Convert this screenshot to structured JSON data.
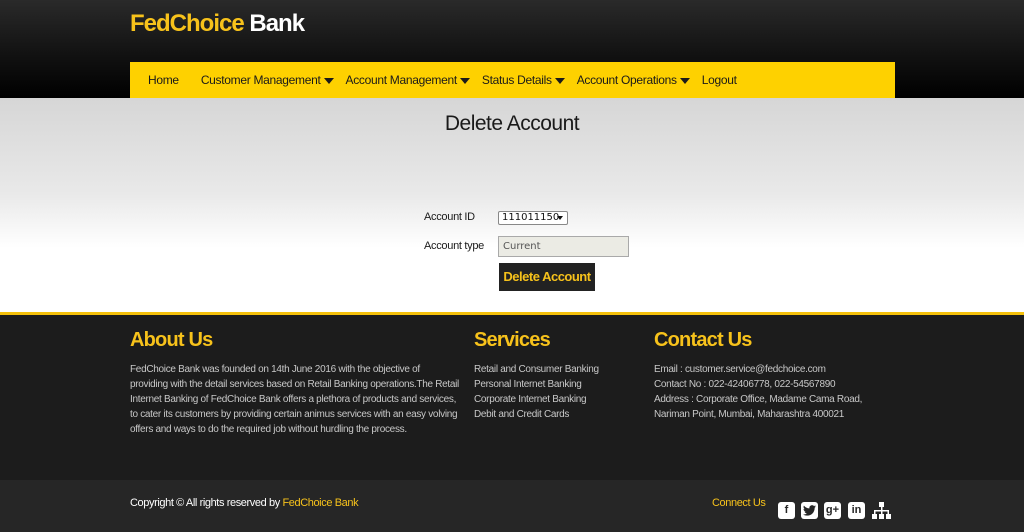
{
  "header": {
    "brand": "FedChoice",
    "brand_suffix": " Bank"
  },
  "nav": {
    "items": [
      {
        "label": "Home",
        "dropdown": false
      },
      {
        "label": "Customer Management",
        "dropdown": true
      },
      {
        "label": "Account Management",
        "dropdown": true
      },
      {
        "label": "Status Details",
        "dropdown": true
      },
      {
        "label": "Account Operations",
        "dropdown": true
      },
      {
        "label": "Logout",
        "dropdown": false
      }
    ]
  },
  "main": {
    "title": "Delete Account",
    "account_id_label": "Account ID",
    "account_id_value": "111011150",
    "account_type_label": "Account type",
    "account_type_value": "Current",
    "submit_label": "Delete Account"
  },
  "footer": {
    "about_title": "About Us",
    "about_text": "FedChoice Bank was founded on 14th June 2016 with the objective of providing with the detail services based on Retail Banking operations.The Retail Internet Banking of FedChoice Bank offers a plethora of products and services, to cater its customers by providing certain animus services with an easy volving offers and ways to do the required job without hurdling the process.",
    "services_title": "Services",
    "services": [
      "Retail and Consumer Banking",
      "Personal Internet Banking",
      "Corporate Internet Banking",
      "Debit and Credit Cards"
    ],
    "contact_title": "Contact Us",
    "contact_lines": [
      "Email : customer.service@fedchoice.com",
      "Contact No : 022-42406778, 022-54567890",
      "Address : Corporate Office, Madame Cama Road,",
      "Nariman Point, Mumbai, Maharashtra 400021"
    ]
  },
  "bottom": {
    "copyright": "Copyright © All rights reserved by ",
    "copyright_bank": "FedChoice Bank",
    "connect_label": "Connect Us",
    "social_icons": [
      "facebook-icon",
      "twitter-icon",
      "google-plus-icon",
      "linkedin-icon",
      "sitemap-icon"
    ]
  },
  "colors": {
    "accent": "#fed100",
    "brand_yellow": "#f7c21b",
    "dark": "#1c1c1c"
  }
}
